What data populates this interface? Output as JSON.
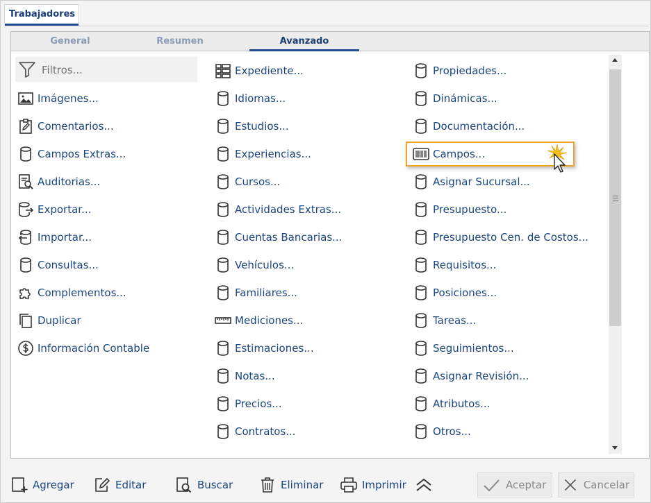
{
  "window": {
    "tab_title": "Trabajadores"
  },
  "subtabs": [
    {
      "label": "General"
    },
    {
      "label": "Resumen"
    },
    {
      "label": "Avanzado"
    }
  ],
  "filter": {
    "placeholder": "Filtros..."
  },
  "columns": {
    "left": [
      {
        "label": "Imágenes...",
        "icon": "image-icon"
      },
      {
        "label": "Comentarios...",
        "icon": "clipboard-edit-icon"
      },
      {
        "label": "Campos Extras...",
        "icon": "database-icon"
      },
      {
        "label": "Auditorias...",
        "icon": "document-search-icon"
      },
      {
        "label": "Exportar...",
        "icon": "database-export-icon"
      },
      {
        "label": "Importar...",
        "icon": "database-import-icon"
      },
      {
        "label": "Consultas...",
        "icon": "database-icon"
      },
      {
        "label": "Complementos...",
        "icon": "puzzle-icon"
      },
      {
        "label": "Duplicar",
        "icon": "copy-icon"
      },
      {
        "label": "Información Contable",
        "icon": "dollar-circle-icon"
      }
    ],
    "middle": [
      {
        "label": "Expediente...",
        "icon": "list-grid-icon"
      },
      {
        "label": "Idiomas...",
        "icon": "database-icon"
      },
      {
        "label": "Estudios...",
        "icon": "database-icon"
      },
      {
        "label": "Experiencias...",
        "icon": "database-icon"
      },
      {
        "label": "Cursos...",
        "icon": "database-icon"
      },
      {
        "label": "Actividades Extras...",
        "icon": "database-icon"
      },
      {
        "label": "Cuentas Bancarias...",
        "icon": "database-icon"
      },
      {
        "label": "Vehículos...",
        "icon": "database-icon"
      },
      {
        "label": "Familiares...",
        "icon": "database-icon"
      },
      {
        "label": "Mediciones...",
        "icon": "ruler-icon"
      },
      {
        "label": "Estimaciones...",
        "icon": "database-icon"
      },
      {
        "label": "Notas...",
        "icon": "database-icon"
      },
      {
        "label": "Precios...",
        "icon": "database-icon"
      },
      {
        "label": "Contratos...",
        "icon": "database-icon"
      }
    ],
    "right": [
      {
        "label": "Propiedades...",
        "icon": "database-icon"
      },
      {
        "label": "Dinámicas...",
        "icon": "database-icon"
      },
      {
        "label": "Documentación...",
        "icon": "database-icon"
      },
      {
        "label": "Campos...",
        "icon": "barcode-icon"
      },
      {
        "label": "Asignar Sucursal...",
        "icon": "database-icon"
      },
      {
        "label": "Presupuesto...",
        "icon": "database-icon"
      },
      {
        "label": "Presupuesto Cen. de Costos...",
        "icon": "database-icon"
      },
      {
        "label": "Requisitos...",
        "icon": "database-icon"
      },
      {
        "label": "Posiciones...",
        "icon": "database-icon"
      },
      {
        "label": "Tareas...",
        "icon": "database-icon"
      },
      {
        "label": "Seguimientos...",
        "icon": "database-icon"
      },
      {
        "label": "Asignar Revisión...",
        "icon": "database-icon"
      },
      {
        "label": "Atributos...",
        "icon": "database-icon"
      },
      {
        "label": "Otros...",
        "icon": "database-icon"
      }
    ]
  },
  "toolbar": {
    "add": "Agregar",
    "edit": "Editar",
    "search": "Buscar",
    "delete": "Eliminar",
    "print": "Imprimir",
    "accept": "Aceptar",
    "cancel": "Cancelar"
  },
  "colors": {
    "accent": "#1f4d94",
    "link": "#1a4681",
    "highlight": "#f0a52a"
  }
}
